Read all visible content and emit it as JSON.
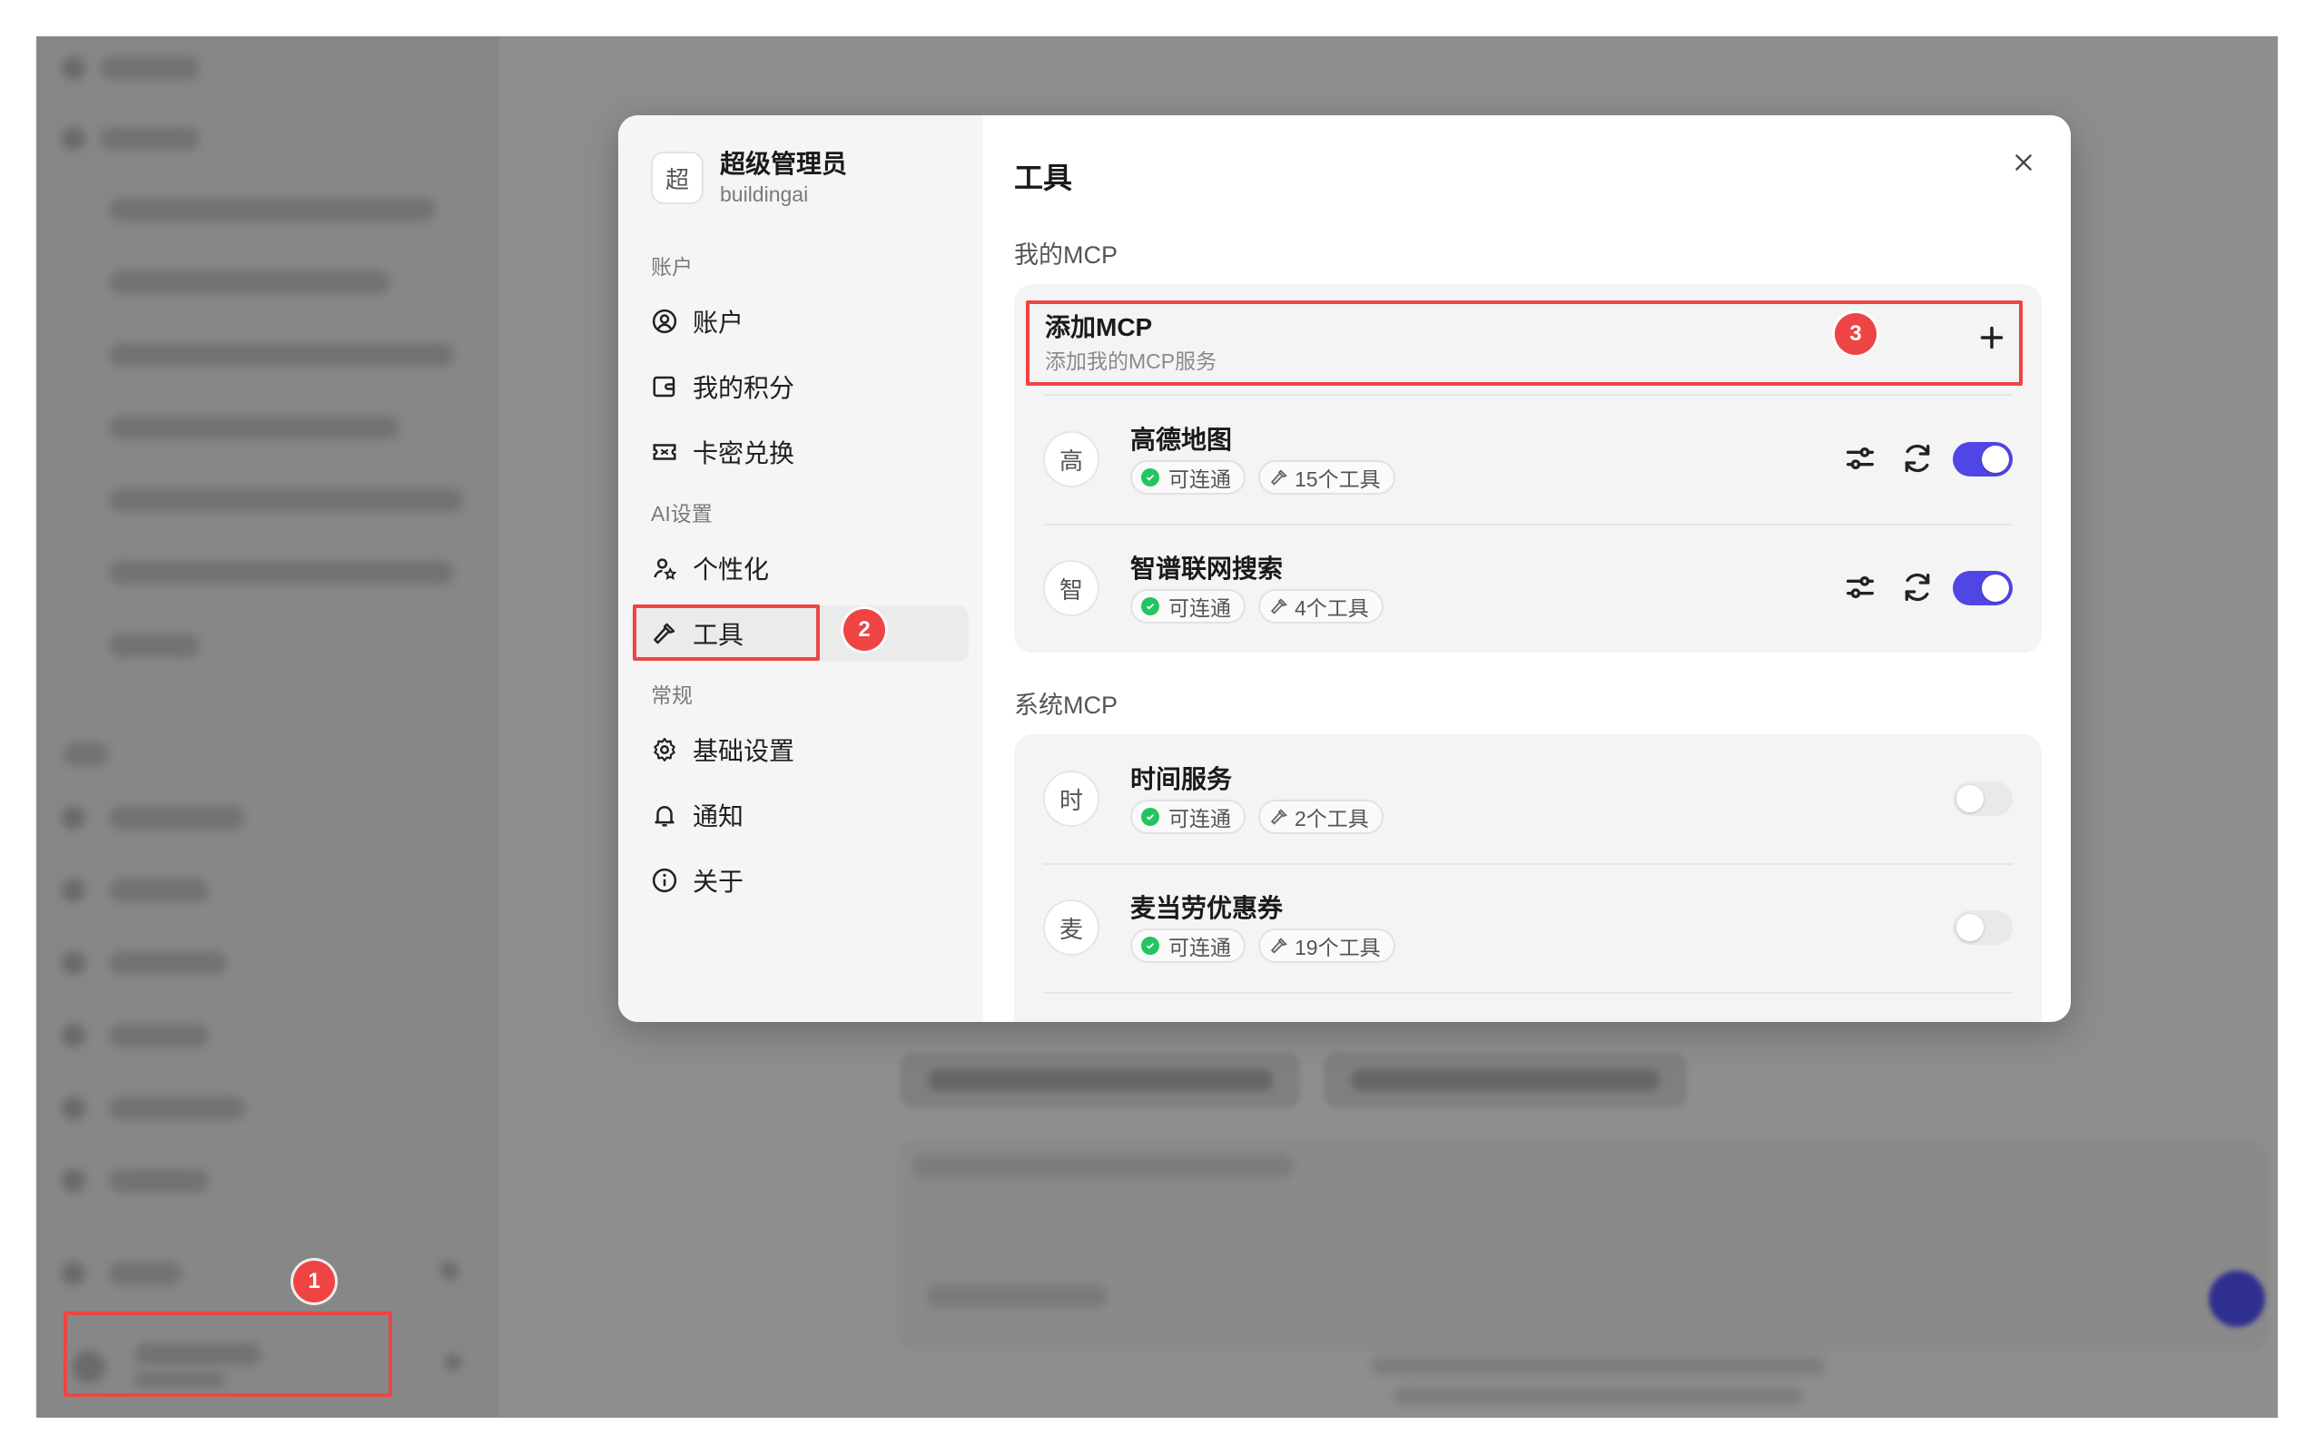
{
  "modal": {
    "profile": {
      "avatar_char": "超",
      "name": "超级管理员",
      "username": "buildingai"
    },
    "sections": {
      "account": "账户",
      "ai": "AI设置",
      "general": "常规"
    },
    "nav": {
      "account": "账户",
      "points": "我的积分",
      "redeem": "卡密兑换",
      "personalize": "个性化",
      "tools": "工具",
      "basic": "基础设置",
      "notify": "通知",
      "about": "关于"
    },
    "title": "工具",
    "my_mcp": {
      "heading": "我的MCP",
      "add": {
        "title": "添加MCP",
        "subtitle": "添加我的MCP服务"
      },
      "items": [
        {
          "char": "高",
          "name": "高德地图",
          "status": "可连通",
          "tools": "15个工具",
          "enabled": true
        },
        {
          "char": "智",
          "name": "智谱联网搜索",
          "status": "可连通",
          "tools": "4个工具",
          "enabled": true
        }
      ]
    },
    "system_mcp": {
      "heading": "系统MCP",
      "items": [
        {
          "char": "时",
          "name": "时间服务",
          "status": "可连通",
          "tools": "2个工具",
          "enabled": false
        },
        {
          "char": "麦",
          "name": "麦当劳优惠券",
          "status": "可连通",
          "tools": "19个工具",
          "enabled": false
        }
      ]
    }
  },
  "annotations": {
    "step1": "1",
    "step2": "2",
    "step3": "3"
  },
  "colors": {
    "accent": "#4f46e5",
    "highlight": "#ef4444",
    "success": "#22c55e"
  }
}
